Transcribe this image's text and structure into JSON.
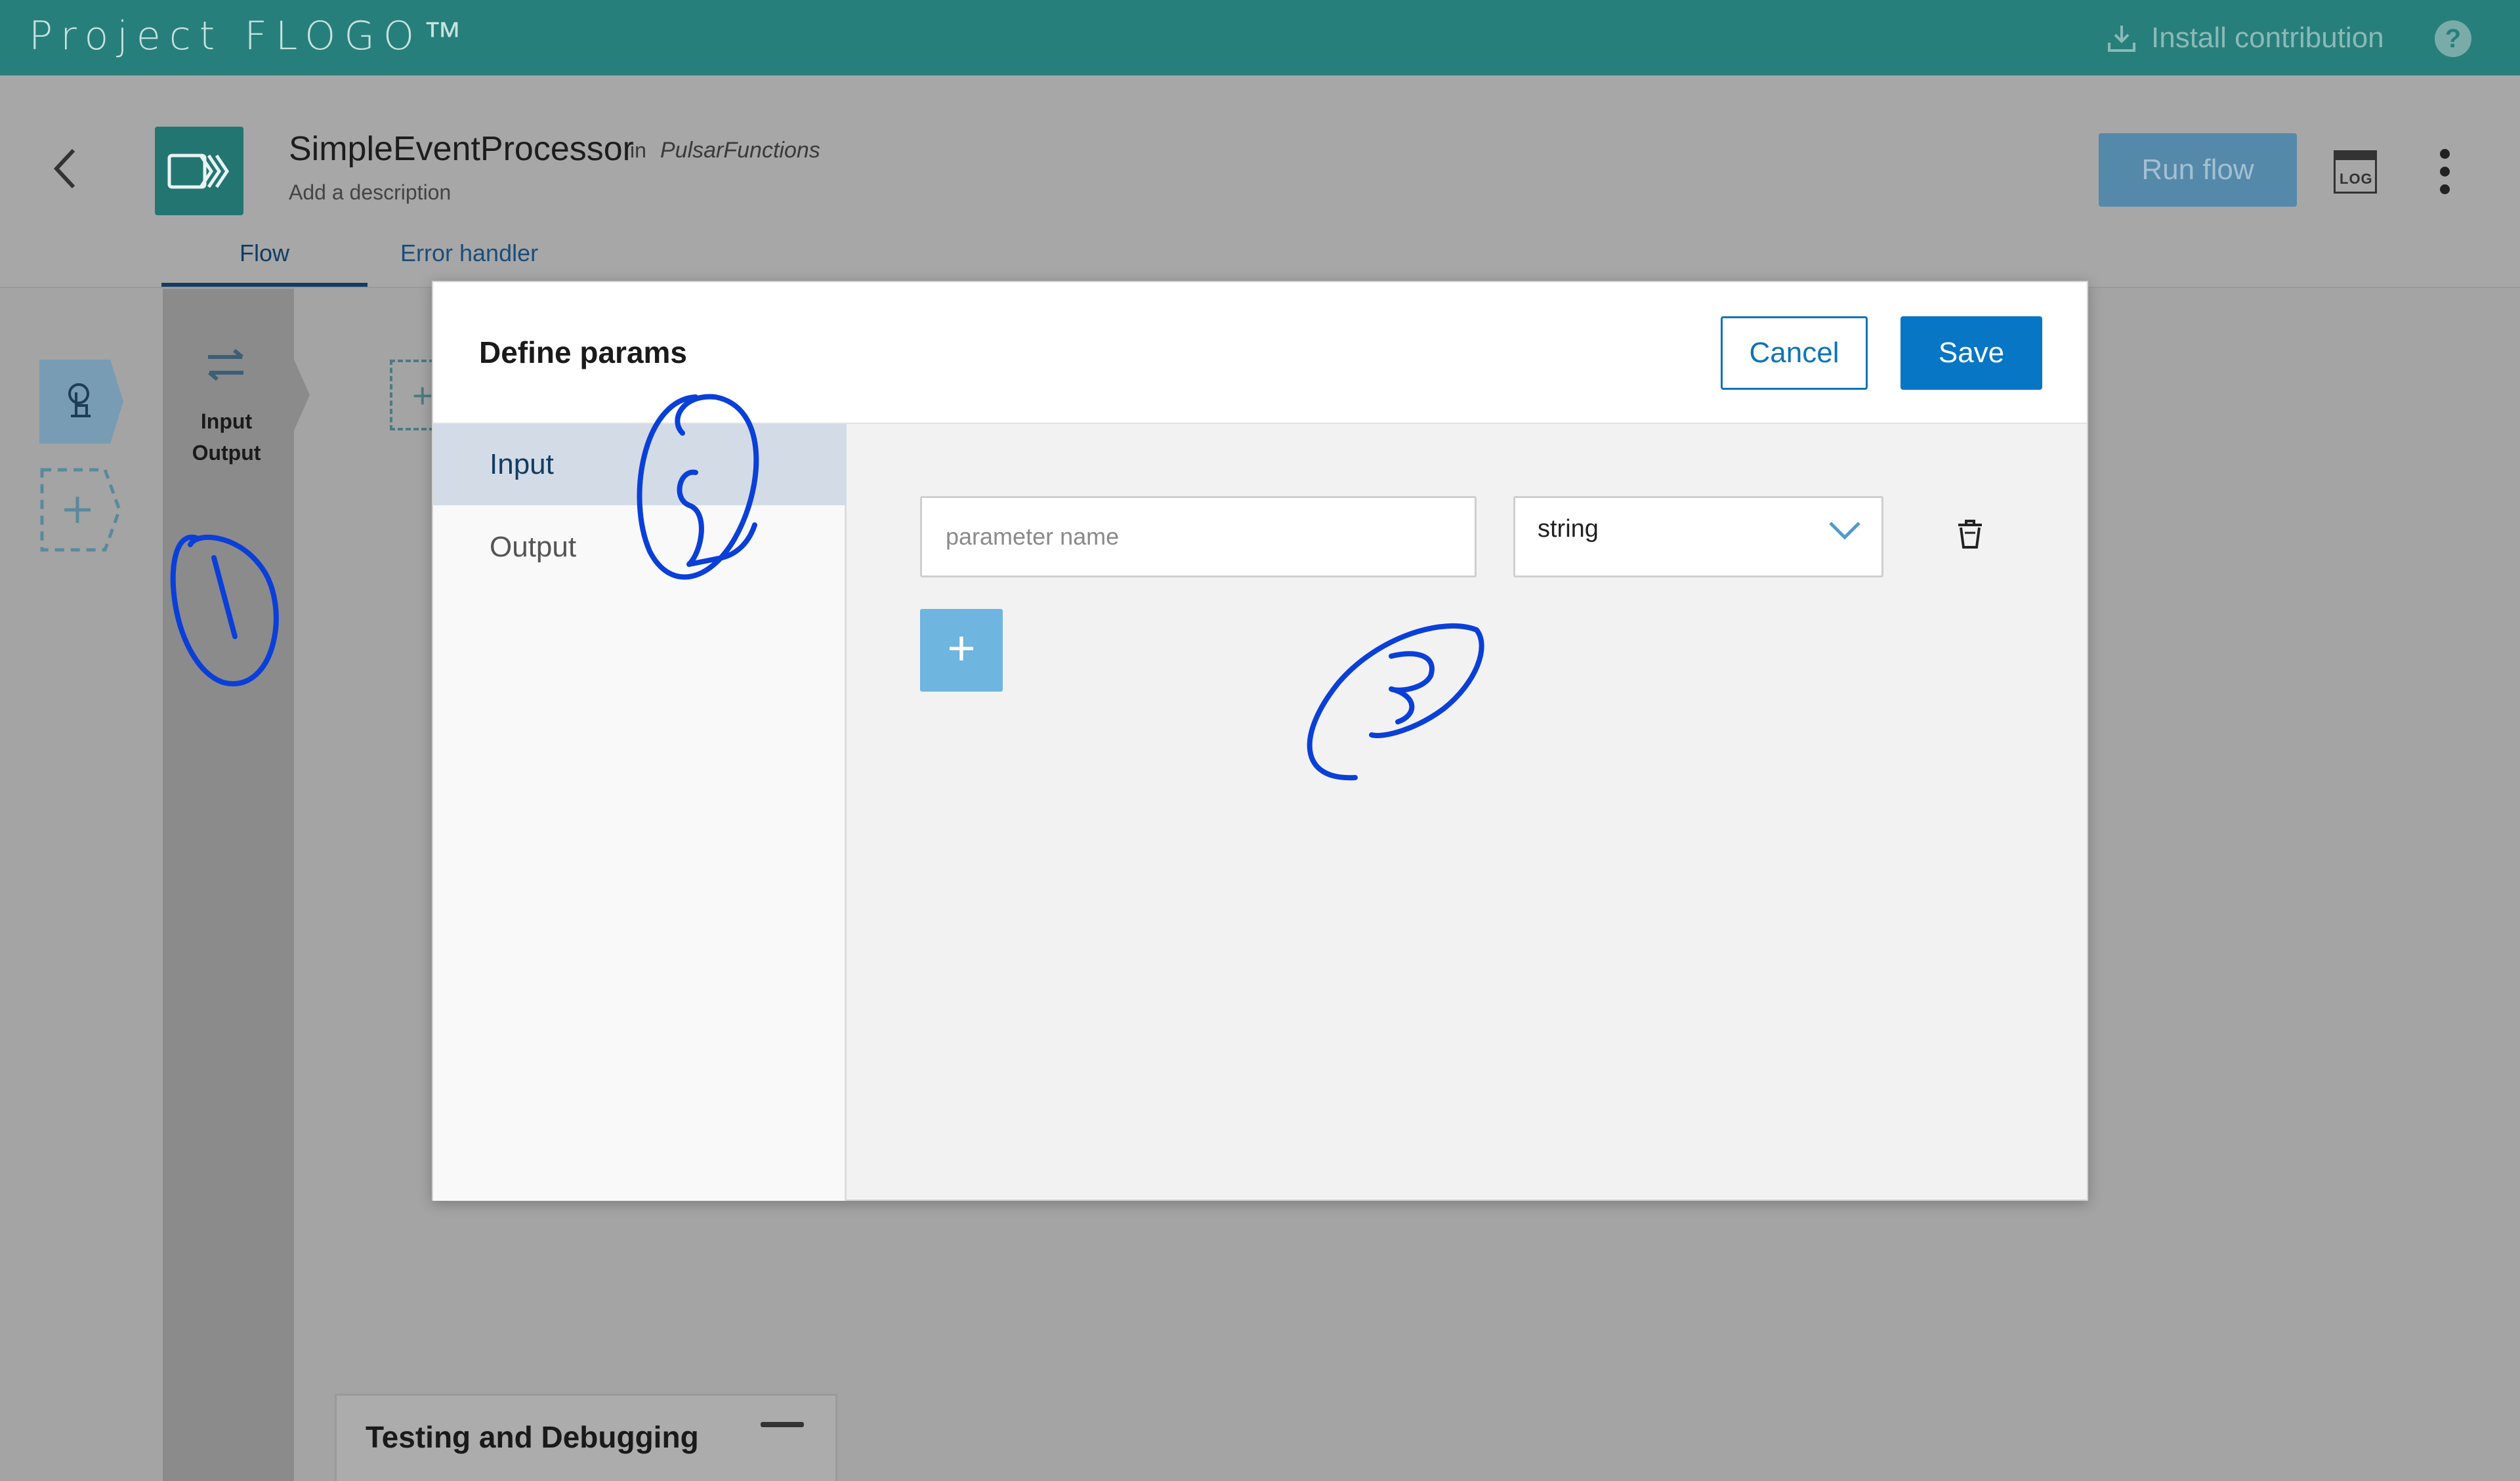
{
  "topbar": {
    "brand": "Project FLOGO™",
    "install_label": "Install contribution",
    "help_label": "?"
  },
  "header": {
    "flow_name": "SimpleEventProcessor",
    "in_label": "in",
    "app_name": "PulsarFunctions",
    "description_placeholder": "Add a description",
    "run_label": "Run flow",
    "log_label": "LOG",
    "tabs": [
      {
        "label": "Flow",
        "active": true
      },
      {
        "label": "Error handler",
        "active": false
      }
    ]
  },
  "canvas": {
    "io_label_line1": "Input",
    "io_label_line2": "Output",
    "add_symbol": "+"
  },
  "testing_panel": {
    "title": "Testing and Debugging"
  },
  "modal": {
    "title": "Define params",
    "cancel_label": "Cancel",
    "save_label": "Save",
    "side_items": [
      {
        "label": "Input",
        "selected": true
      },
      {
        "label": "Output",
        "selected": false
      }
    ],
    "param_name_placeholder": "parameter name",
    "param_type_value": "string",
    "add_param_symbol": "+"
  },
  "annotations": [
    "1",
    "2",
    "3"
  ],
  "colors": {
    "topbar": "#277f7b",
    "primary_button": "#0776c4",
    "ink": "#0a3fd8"
  }
}
